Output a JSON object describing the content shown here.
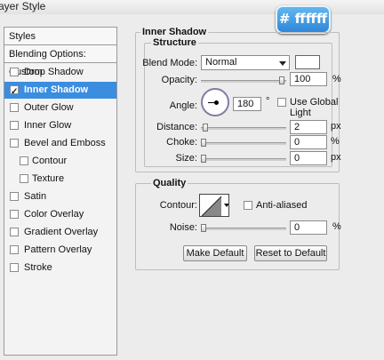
{
  "window": {
    "title": "ayer Style"
  },
  "badge": {
    "text": "# ffffff",
    "color": "#3b95e2"
  },
  "sidebar": {
    "header": "Styles",
    "blending": "Blending Options: Custom",
    "items": [
      {
        "label": "Drop Shadow",
        "checked": false
      },
      {
        "label": "Inner Shadow",
        "checked": true,
        "active": true
      },
      {
        "label": "Outer Glow",
        "checked": false
      },
      {
        "label": "Inner Glow",
        "checked": false
      },
      {
        "label": "Bevel and Emboss",
        "checked": false
      },
      {
        "label": "Contour",
        "checked": false
      },
      {
        "label": "Texture",
        "checked": false
      },
      {
        "label": "Satin",
        "checked": false
      },
      {
        "label": "Color Overlay",
        "checked": false
      },
      {
        "label": "Gradient Overlay",
        "checked": false
      },
      {
        "label": "Pattern Overlay",
        "checked": false
      },
      {
        "label": "Stroke",
        "checked": false
      }
    ],
    "active_color": "#3b8de0"
  },
  "panel": {
    "title": "Inner Shadow",
    "structure": {
      "title": "Structure",
      "blend_mode_label": "Blend Mode:",
      "blend_mode_value": "Normal",
      "blend_color": "#ffffff",
      "opacity_label": "Opacity:",
      "opacity_value": "100",
      "opacity_unit": "%",
      "angle_label": "Angle:",
      "angle_value": "180",
      "angle_unit": "°",
      "global_light_label": "Use Global Light",
      "global_light_checked": false,
      "distance_label": "Distance:",
      "distance_value": "2",
      "distance_unit": "px",
      "choke_label": "Choke:",
      "choke_value": "0",
      "choke_unit": "%",
      "size_label": "Size:",
      "size_value": "0",
      "size_unit": "px"
    },
    "quality": {
      "title": "Quality",
      "contour_label": "Contour:",
      "anti_aliased_label": "Anti-aliased",
      "anti_aliased_checked": false,
      "noise_label": "Noise:",
      "noise_value": "0",
      "noise_unit": "%"
    },
    "buttons": {
      "make_default": "Make Default",
      "reset_default": "Reset to Default"
    }
  }
}
